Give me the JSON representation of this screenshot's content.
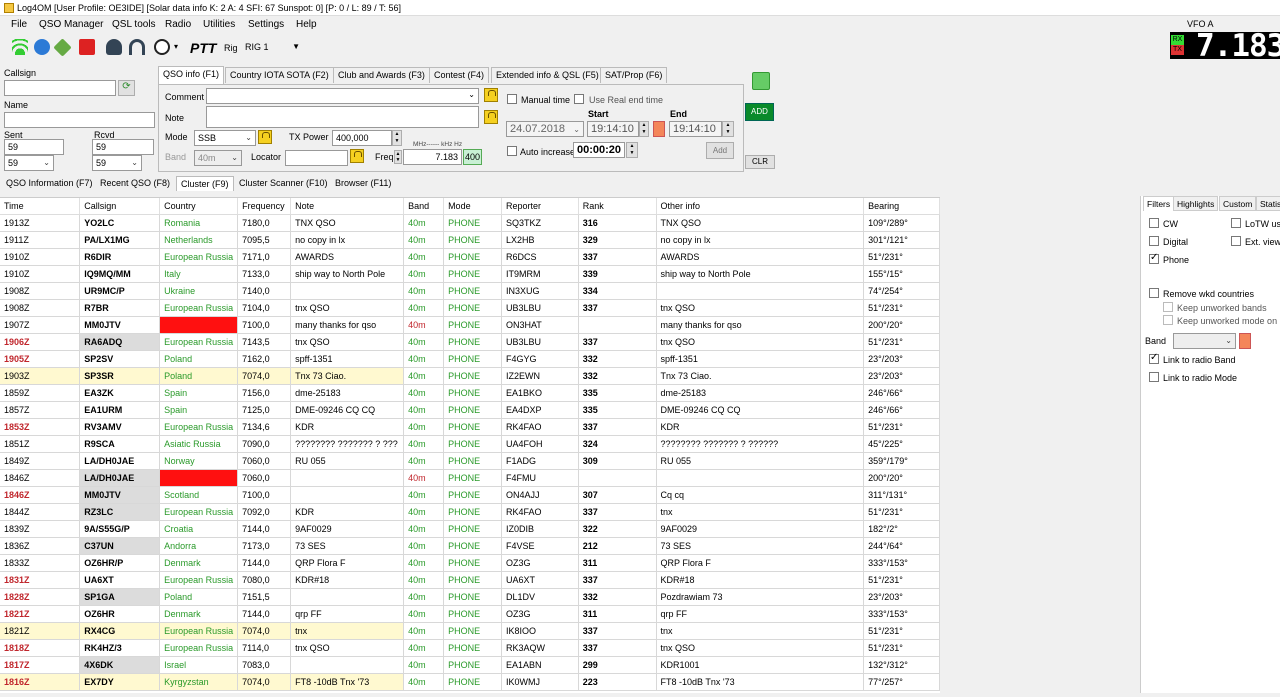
{
  "window": {
    "title": "Log4OM [User Profile: OE3IDE] [Solar data info K: 2 A: 4 SFI: 67 Sunspot: 0] [P: 0 / L: 89 / T: 56]"
  },
  "menu": [
    "File",
    "QSO Manager",
    "QSL tools",
    "Radio",
    "Utilities",
    "Settings",
    "Help"
  ],
  "toolbar": {
    "ptt": "PTT",
    "rig_label": "Rig",
    "rig_value": "RIG 1",
    "icons": [
      "wifi-icon",
      "globe-icon",
      "satellite-icon",
      "pdf-icon",
      "headset-icon",
      "dish-icon"
    ]
  },
  "vfo": {
    "label": "VFO A",
    "rx": "RX",
    "tx": "TX",
    "freq": "7.183"
  },
  "left": {
    "callsign_label": "Callsign",
    "callsign_value": "",
    "name_label": "Name",
    "name_value": "",
    "sent_label": "Sent",
    "rcvd_label": "Rcvd",
    "sent_value": "59",
    "rcvd_value": "59",
    "sent_select": "59",
    "rcvd_select": "59"
  },
  "tabs": [
    "QSO info (F1)",
    "Country IOTA SOTA (F2)",
    "Club and Awards (F3)",
    "Contest (F4)",
    "Extended info & QSL (F5)",
    "SAT/Prop (F6)"
  ],
  "qso": {
    "comment_label": "Comment",
    "note_label": "Note",
    "mode_label": "Mode",
    "mode_value": "SSB",
    "txpower_label": "TX Power",
    "txpower_value": "400,000",
    "band_label": "Band",
    "band_value": "40m",
    "locator_label": "Locator",
    "freq_label": "Freq",
    "freq_units": "MHz------ kHz   Hz",
    "freq_value": "7.183",
    "freq_hz": "400"
  },
  "time": {
    "manual_label": "Manual time",
    "realend_label": "Use Real end time",
    "start_label": "Start",
    "end_label": "End",
    "date": "24.07.2018",
    "start": "19:14:10",
    "end": "19:14:10",
    "auto_label": "Auto increase",
    "auto_value": "00:00:20",
    "add_label": "Add",
    "add_btn": "ADD",
    "clr_btn": "CLR"
  },
  "bottom_tabs": [
    "QSO Information (F7)",
    "Recent QSO (F8)",
    "Cluster (F9)",
    "Cluster Scanner (F10)",
    "Browser (F11)"
  ],
  "columns": [
    "Time",
    "Callsign",
    "Country",
    "Frequency",
    "Note",
    "Band",
    "Mode",
    "Reporter",
    "Rank",
    "Other info",
    "Bearing"
  ],
  "rows": [
    [
      "1913Z",
      "YO2LC",
      "Romania",
      "7180,0",
      "TNX QSO",
      "40m",
      "PHONE",
      "SQ3TKZ",
      "316",
      "TNX QSO",
      "109°/289°"
    ],
    [
      "1911Z",
      "PA/LX1MG",
      "Netherlands",
      "7095,5",
      "no  copy in lx",
      "40m",
      "PHONE",
      "LX2HB",
      "329",
      "no  copy in lx",
      "301°/121°"
    ],
    [
      "1910Z",
      "R6DIR",
      "European Russia",
      "7171,0",
      "AWARDS",
      "40m",
      "PHONE",
      "R6DCS",
      "337",
      "AWARDS",
      "51°/231°"
    ],
    [
      "1910Z",
      "IQ9MQ/MM",
      "Italy",
      "7133,0",
      "ship way to North Pole",
      "40m",
      "PHONE",
      "IT9MRM",
      "339",
      "ship way to North Pole",
      "155°/15°"
    ],
    [
      "1908Z",
      "UR9MC/P",
      "Ukraine",
      "7140,0",
      "",
      "40m",
      "PHONE",
      "IN3XUG",
      "334",
      "",
      "74°/254°"
    ],
    [
      "1908Z",
      "R7BR",
      "European Russia",
      "7104,0",
      "tnx QSO",
      "40m",
      "PHONE",
      "UB3LBU",
      "337",
      "tnx QSO",
      "51°/231°"
    ],
    [
      "1907Z",
      "MM0JTV",
      "",
      "7100,0",
      "many thanks for qso",
      "40m",
      "PHONE",
      "ON3HAT",
      "",
      "many thanks for qso",
      "200°/20°"
    ],
    [
      "1906Z",
      "RA6ADQ",
      "European Russia",
      "7143,5",
      "tnx QSO",
      "40m",
      "PHONE",
      "UB3LBU",
      "337",
      "tnx QSO",
      "51°/231°"
    ],
    [
      "1905Z",
      "SP2SV",
      "Poland",
      "7162,0",
      "spff-1351",
      "40m",
      "PHONE",
      "F4GYG",
      "332",
      "spff-1351",
      "23°/203°"
    ],
    [
      "1903Z",
      "SP3SR",
      "Poland",
      "7074,0",
      "Tnx 73 Ciao.",
      "40m",
      "PHONE",
      "IZ2EWN",
      "332",
      "Tnx 73 Ciao.",
      "23°/203°"
    ],
    [
      "1859Z",
      "EA3ZK",
      "Spain",
      "7156,0",
      "dme-25183",
      "40m",
      "PHONE",
      "EA1BKO",
      "335",
      "dme-25183",
      "246°/66°"
    ],
    [
      "1857Z",
      "EA1URM",
      "Spain",
      "7125,0",
      "DME-09246 CQ CQ",
      "40m",
      "PHONE",
      "EA4DXP",
      "335",
      "DME-09246 CQ CQ",
      "246°/66°"
    ],
    [
      "1853Z",
      "RV3AMV",
      "European Russia",
      "7134,6",
      "KDR",
      "40m",
      "PHONE",
      "RK4FAO",
      "337",
      "KDR",
      "51°/231°"
    ],
    [
      "1851Z",
      "R9SCA",
      "Asiatic Russia",
      "7090,0",
      "???????? ??????? ?  ???",
      "40m",
      "PHONE",
      "UA4FOH",
      "324",
      "???????? ??????? ?  ??????",
      "45°/225°"
    ],
    [
      "1849Z",
      "LA/DH0JAE",
      "Norway",
      "7060,0",
      "RU 055",
      "40m",
      "PHONE",
      "F1ADG",
      "309",
      "RU 055",
      "359°/179°"
    ],
    [
      "1846Z",
      "LA/DH0JAE",
      "",
      "7060,0",
      "",
      "40m",
      "PHONE",
      "F4FMU",
      "",
      "",
      "200°/20°"
    ],
    [
      "1846Z",
      "MM0JTV",
      "Scotland",
      "7100,0",
      "",
      "40m",
      "PHONE",
      "ON4AJJ",
      "307",
      "Cq cq",
      "311°/131°"
    ],
    [
      "1844Z",
      "RZ3LC",
      "European Russia",
      "7092,0",
      "KDR",
      "40m",
      "PHONE",
      "RK4FAO",
      "337",
      "tnx",
      "51°/231°"
    ],
    [
      "1839Z",
      "9A/S55G/P",
      "Croatia",
      "7144,0",
      "9AF0029",
      "40m",
      "PHONE",
      "IZ0DIB",
      "322",
      "9AF0029",
      "182°/2°"
    ],
    [
      "1836Z",
      "C37UN",
      "Andorra",
      "7173,0",
      "73 SES",
      "40m",
      "PHONE",
      "F4VSE",
      "212",
      "73 SES",
      "244°/64°"
    ],
    [
      "1833Z",
      "OZ6HR/P",
      "Denmark",
      "7144,0",
      "QRP Flora F",
      "40m",
      "PHONE",
      "OZ3G",
      "311",
      "QRP Flora F",
      "333°/153°"
    ],
    [
      "1831Z",
      "UA6XT",
      "European Russia",
      "7080,0",
      "KDR#18",
      "40m",
      "PHONE",
      "UA6XT",
      "337",
      "KDR#18",
      "51°/231°"
    ],
    [
      "1828Z",
      "SP1GA",
      "Poland",
      "7151,5",
      "",
      "40m",
      "PHONE",
      "DL1DV",
      "332",
      "Pozdrawiam 73",
      "23°/203°"
    ],
    [
      "1821Z",
      "OZ6HR",
      "Denmark",
      "7144,0",
      "qrp FF",
      "40m",
      "PHONE",
      "OZ3G",
      "311",
      "qrp FF",
      "333°/153°"
    ],
    [
      "1821Z",
      "RX4CG",
      "European Russia",
      "7074,0",
      "tnx",
      "40m",
      "PHONE",
      "IK8IOO",
      "337",
      "tnx",
      "51°/231°"
    ],
    [
      "1818Z",
      "RK4HZ/3",
      "European Russia",
      "7114,0",
      "tnx QSO",
      "40m",
      "PHONE",
      "RK3AQW",
      "337",
      "tnx QSO",
      "51°/231°"
    ],
    [
      "1817Z",
      "4X6DK",
      "Israel",
      "7083,0",
      "",
      "40m",
      "PHONE",
      "EA1ABN",
      "299",
      "KDR1001",
      "132°/312°"
    ],
    [
      "1816Z",
      "EX7DY",
      "Kyrgyzstan",
      "7074,0",
      "FT8 -10dB Tnx '73",
      "40m",
      "PHONE",
      "IK0WMJ",
      "223",
      "FT8 -10dB Tnx '73",
      "77°/257°"
    ]
  ],
  "filters": {
    "tabs": [
      "Filters",
      "Highlights",
      "Custom",
      "Statis"
    ],
    "cw": "CW",
    "lotw": "LoTW us",
    "digital": "Digital",
    "extview": "Ext. view",
    "phone": "Phone",
    "remove": "Remove wkd countries",
    "keep_bands": "Keep unworked bands",
    "keep_mode": "Keep unworked mode on ba",
    "band_label": "Band",
    "link_band": "Link to radio Band",
    "link_mode": "Link to radio Mode"
  }
}
